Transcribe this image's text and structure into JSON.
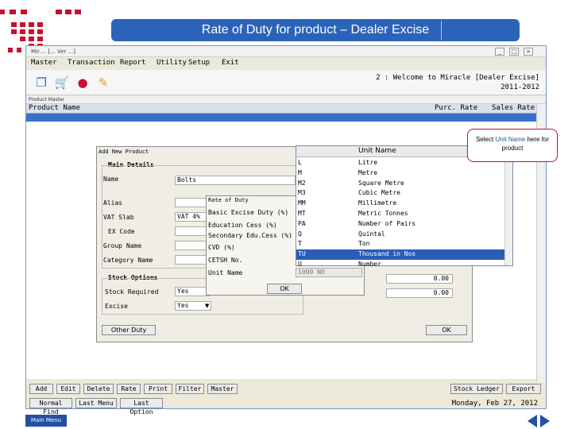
{
  "slide_title": "Rate of Duty for product – Dealer Excise",
  "window": {
    "title": "Mir.... [... Ver ...]"
  },
  "menu": [
    "Master",
    "Transaction",
    "Report",
    "Utility",
    "Setup",
    "Exit"
  ],
  "welcome": {
    "line1": "2 : Welcome to Miracle [Dealer Excise]",
    "line2": "2011-2012"
  },
  "product_master": {
    "bar_title": "Product Master",
    "col_name": "Product Name",
    "col_purc": "Purc. Rate",
    "col_sales": "Sales Rate"
  },
  "buttons_row1": [
    "Add",
    "Edit",
    "Delete",
    "Rate",
    "Print",
    "Filter",
    "Master"
  ],
  "buttons_right": [
    "Stock Ledger",
    "Export"
  ],
  "buttons_row2": [
    "Normal Find",
    "Last Menu",
    "Last Option"
  ],
  "date": "Monday, Feb 27, 2012",
  "add_product": {
    "title": "Add New Product",
    "main_details": "Main Details",
    "name_label": "Name",
    "name_value": "Bolts",
    "alias_label": "Alias",
    "vat_label": "VAT Slab",
    "vat_value": "VAT 4%",
    "ex_label": "EX Code",
    "group_label": "Group Name",
    "category_label": "Category Name",
    "stock_options": "Stock Options",
    "stock_required_label": "Stock Required",
    "stock_required_value": "Yes",
    "excise_label": "Excise",
    "excise_value": "Yes",
    "other_duty": "Other Duty",
    "ok": "OK",
    "amount1": "0.00",
    "amount2": "0.00"
  },
  "rate_of_duty": {
    "title": "Rate of Duty",
    "labels": [
      "Basic Excise Duty (%)",
      "Education Cess (%)",
      "Secondary Edu.Cess (%)",
      "CVD (%)",
      "CETSH No.",
      "Unit Name"
    ],
    "unit_value": "1000 NO",
    "ok": "OK"
  },
  "unit_list": {
    "header": "Unit Name",
    "rows": [
      {
        "code": "L",
        "name": "Litre"
      },
      {
        "code": "M",
        "name": "Metre"
      },
      {
        "code": "M2",
        "name": "Square Metre"
      },
      {
        "code": "M3",
        "name": "Cubic Metre"
      },
      {
        "code": "MM",
        "name": "Millimetre"
      },
      {
        "code": "MT",
        "name": "Metric Tonnes"
      },
      {
        "code": "PA",
        "name": "Number of Pairs"
      },
      {
        "code": "Q",
        "name": "Quintal"
      },
      {
        "code": "T",
        "name": "Ton"
      },
      {
        "code": "TU",
        "name": "Thousand in Nos"
      },
      {
        "code": "U",
        "name": "Number"
      }
    ],
    "selected_index": 9
  },
  "callout": {
    "pre": "Select ",
    "highlight": "Unit Name",
    "post": " here for product"
  },
  "main_menu": "Main Menu",
  "colors": {
    "accent": "#c8102e",
    "title_bar": "#2b63b8",
    "selection": "#2a5cb8"
  }
}
